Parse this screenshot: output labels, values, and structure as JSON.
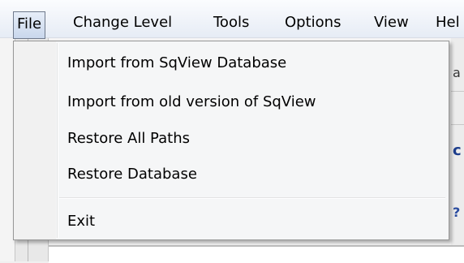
{
  "menubar": {
    "items": [
      {
        "label": "File",
        "active": true
      },
      {
        "label": "Change Level"
      },
      {
        "label": "Tools"
      },
      {
        "label": "Options"
      },
      {
        "label": "View"
      },
      {
        "label": "Hel"
      }
    ]
  },
  "file_menu": {
    "items": [
      {
        "label": "Import from SqView Database"
      },
      {
        "label": "Import from old version of SqView"
      },
      {
        "label": "Restore All Paths"
      },
      {
        "label": "Restore Database"
      },
      {
        "label": "Exit"
      }
    ]
  },
  "background": {
    "fragments": [
      "a",
      "c",
      "?"
    ]
  },
  "colors": {
    "active_menu_border": "#6f7a8c",
    "menu_background": "#f5f6f7",
    "fragment_text": "#1c3d8c"
  }
}
